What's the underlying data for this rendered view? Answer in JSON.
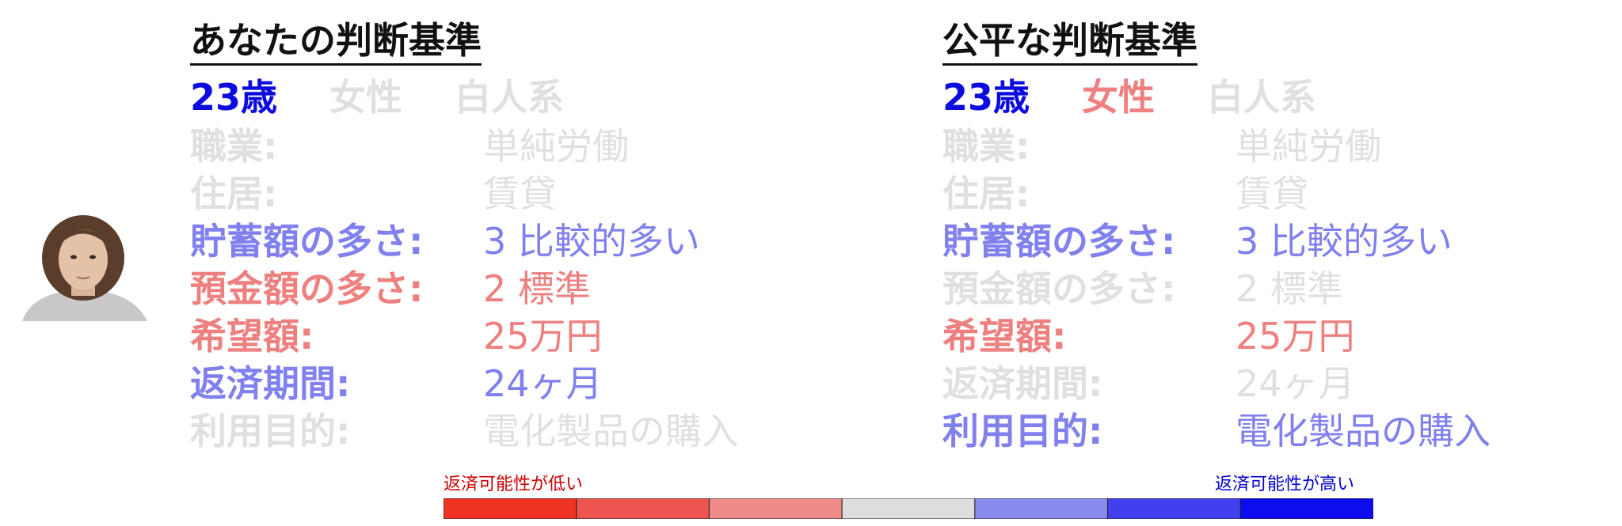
{
  "palette": {
    "strong_blue": "#0c0ce0",
    "light_blue": "#8080ee",
    "light_red": "#ee8080",
    "gray": "#e0e0e0",
    "dark_text": "#111111"
  },
  "left_panel": {
    "title": "あなたの判断基準",
    "demographics": [
      {
        "text": "23歳",
        "color": "#0c0ce0"
      },
      {
        "text": "女性",
        "color": "#e0e0e0"
      },
      {
        "text": "白人系",
        "color": "#e0e0e0"
      }
    ],
    "rows": [
      {
        "label": "職業:",
        "value": "単純労働",
        "color": "#e0e0e0"
      },
      {
        "label": "住居:",
        "value": "賃貸",
        "color": "#e0e0e0"
      },
      {
        "label": "貯蓄額の多さ:",
        "value": "3 比較的多い",
        "color": "#8080ee"
      },
      {
        "label": "預金額の多さ:",
        "value": "2 標準",
        "color": "#ee8080"
      },
      {
        "label": "希望額:",
        "value": "25万円",
        "color": "#ee8080"
      },
      {
        "label": "返済期間:",
        "value": "24ヶ月",
        "color": "#8080ee"
      },
      {
        "label": "利用目的:",
        "value": "電化製品の購入",
        "color": "#e0e0e0"
      }
    ]
  },
  "right_panel": {
    "title": "公平な判断基準",
    "demographics": [
      {
        "text": "23歳",
        "color": "#0c0ce0"
      },
      {
        "text": "女性",
        "color": "#ee8080"
      },
      {
        "text": "白人系",
        "color": "#e0e0e0"
      }
    ],
    "rows": [
      {
        "label": "職業:",
        "value": "単純労働",
        "color": "#e0e0e0"
      },
      {
        "label": "住居:",
        "value": "賃貸",
        "color": "#e0e0e0"
      },
      {
        "label": "貯蓄額の多さ:",
        "value": "3 比較的多い",
        "color": "#8080ee"
      },
      {
        "label": "預金額の多さ:",
        "value": "2 標準",
        "color": "#e0e0e0"
      },
      {
        "label": "希望額:",
        "value": "25万円",
        "color": "#ee8080"
      },
      {
        "label": "返済期間:",
        "value": "24ヶ月",
        "color": "#e0e0e0"
      },
      {
        "label": "利用目的:",
        "value": "電化製品の購入",
        "color": "#8080ee"
      }
    ]
  },
  "scale": {
    "low_label": "返済可能性が低い",
    "high_label": "返済可能性が高い",
    "low_color": "#cc0000",
    "high_color": "#0000cc",
    "segments": [
      "#ee3322",
      "#ee5550",
      "#ee8a88",
      "#dddddd",
      "#8a8aee",
      "#4040ee",
      "#0c0cee"
    ]
  }
}
